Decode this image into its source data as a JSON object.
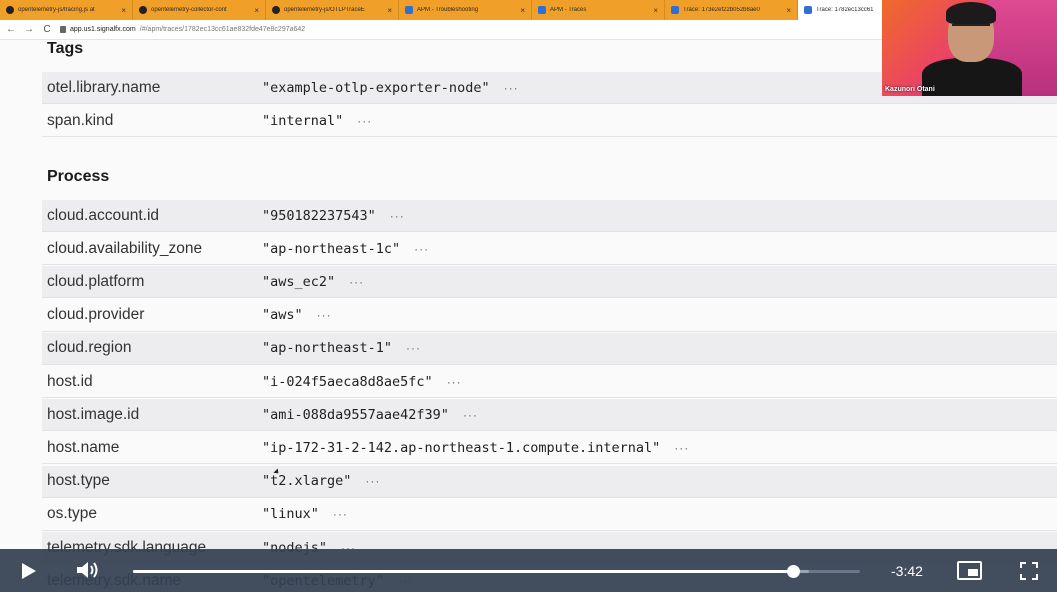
{
  "browser": {
    "tabs": [
      {
        "title": "opentelemetry-js/tracing.js at",
        "icon": "github-icon"
      },
      {
        "title": "opentelemetry-collector-cont",
        "icon": "github-icon"
      },
      {
        "title": "opentelemetry-js/OTLPTraceE",
        "icon": "github-icon"
      },
      {
        "title": "APM - Troubleshooting",
        "icon": "signalfx-icon"
      },
      {
        "title": "APM - Traces",
        "icon": "signalfx-icon"
      },
      {
        "title": "Trace: 173e2ef22b052b8ae0",
        "icon": "signalfx-icon"
      },
      {
        "title": "Trace: 1782ec13cc61",
        "icon": "signalfx-icon",
        "active": true
      }
    ],
    "close_glyph": "×",
    "nav": {
      "back": "←",
      "forward": "→",
      "reload": "C"
    },
    "url_host": "app.us1.signalfx.com",
    "url_path": "/#/apm/traces/1782ec13cc61ae832fde47e8c297a642"
  },
  "tags_section": {
    "title": "Tags",
    "rows": [
      {
        "key": "otel.library.name",
        "value": "\"example-otlp-exporter-node\""
      },
      {
        "key": "span.kind",
        "value": "\"internal\""
      }
    ]
  },
  "process_section": {
    "title": "Process",
    "rows": [
      {
        "key": "cloud.account.id",
        "value": "\"950182237543\""
      },
      {
        "key": "cloud.availability_zone",
        "value": "\"ap-northeast-1c\""
      },
      {
        "key": "cloud.platform",
        "value": "\"aws_ec2\""
      },
      {
        "key": "cloud.provider",
        "value": "\"aws\""
      },
      {
        "key": "cloud.region",
        "value": "\"ap-northeast-1\""
      },
      {
        "key": "host.id",
        "value": "\"i-024f5aeca8d8ae5fc\""
      },
      {
        "key": "host.image.id",
        "value": "\"ami-088da9557aae42f39\""
      },
      {
        "key": "host.name",
        "value": "\"ip-172-31-2-142.ap-northeast-1.compute.internal\""
      },
      {
        "key": "host.type",
        "value": "\"t2.xlarge\""
      },
      {
        "key": "os.type",
        "value": "\"linux\""
      },
      {
        "key": "telemetry.sdk.language",
        "value": "\"nodejs\""
      },
      {
        "key": "telemetry.sdk.name",
        "value": "\"opentelemetry\""
      }
    ]
  },
  "more_glyph": "···",
  "webcam": {
    "presenter_name": "Kazunori Otani"
  },
  "player": {
    "time_remaining": "-3:42",
    "progress": 0.908,
    "buffered": 0.93
  }
}
